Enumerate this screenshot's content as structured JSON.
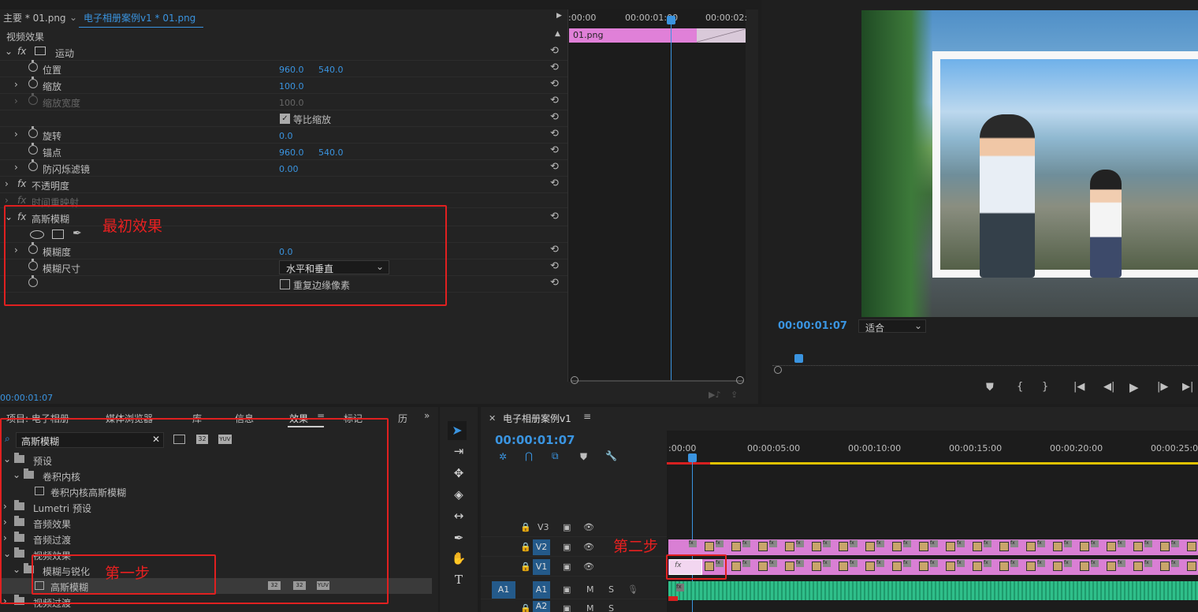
{
  "effect_controls": {
    "master_tab": "主要 * 01.png",
    "seq_tab": "电子相册案例v1 * 01.png",
    "section": "视频效果",
    "timecode": "00:00:01:07",
    "mini_timeline": {
      "ticks": [
        ":00:00",
        "00:00:01:00",
        "00:00:02:"
      ],
      "clip": "01.png"
    },
    "motion": {
      "label": "运动",
      "position": {
        "label": "位置",
        "x": "960.0",
        "y": "540.0"
      },
      "scale": {
        "label": "缩放",
        "value": "100.0"
      },
      "scale_width": {
        "label": "缩放宽度",
        "value": "100.0"
      },
      "uniform": "等比缩放",
      "rotation": {
        "label": "旋转",
        "value": "0.0"
      },
      "anchor": {
        "label": "锚点",
        "x": "960.0",
        "y": "540.0"
      },
      "antiflicker": {
        "label": "防闪烁滤镜",
        "value": "0.00"
      }
    },
    "opacity": "不透明度",
    "time_remap": "时间重映射",
    "gaussian": {
      "label": "高斯模糊",
      "blurriness": {
        "label": "模糊度",
        "value": "0.0"
      },
      "dimensions": {
        "label": "模糊尺寸",
        "value": "水平和垂直"
      },
      "repeat_edge": "重复边缘像素"
    }
  },
  "monitor": {
    "timecode": "00:00:01:07",
    "fit": "适合"
  },
  "project_panel": {
    "tabs": [
      "项目: 电子相册",
      "媒体浏览器",
      "库",
      "信息",
      "效果",
      "标记",
      "历"
    ],
    "search_value": "高斯模糊",
    "tree": [
      {
        "label": "预设",
        "level": 0
      },
      {
        "label": "卷积内核",
        "level": 1
      },
      {
        "label": "卷积内核高斯模糊",
        "level": 2
      },
      {
        "label": "Lumetri 预设",
        "level": 0
      },
      {
        "label": "音频效果",
        "level": 0
      },
      {
        "label": "音频过渡",
        "level": 0
      },
      {
        "label": "视频效果",
        "level": 0
      },
      {
        "label": "模糊与锐化",
        "level": 1
      },
      {
        "label": "高斯模糊",
        "level": 2
      },
      {
        "label": "视频过渡",
        "level": 0
      }
    ]
  },
  "timeline": {
    "title": "电子相册案例v1",
    "timecode": "00:00:01:07",
    "ticks": [
      ":00:00",
      "00:00:05:00",
      "00:00:10:00",
      "00:00:15:00",
      "00:00:20:00",
      "00:00:25:00"
    ],
    "tracks": [
      "V3",
      "V2",
      "V1",
      "A1",
      "A2"
    ],
    "source_a1": "A1",
    "mute": "M",
    "solo": "S"
  },
  "annotations": {
    "initial": "最初效果",
    "step1": "第一步",
    "step2": "第二步"
  },
  "colors": {
    "accent": "#3a94e0",
    "clip": "#d97fd4",
    "audio": "#2fbf8a",
    "annotation": "#e02020"
  }
}
